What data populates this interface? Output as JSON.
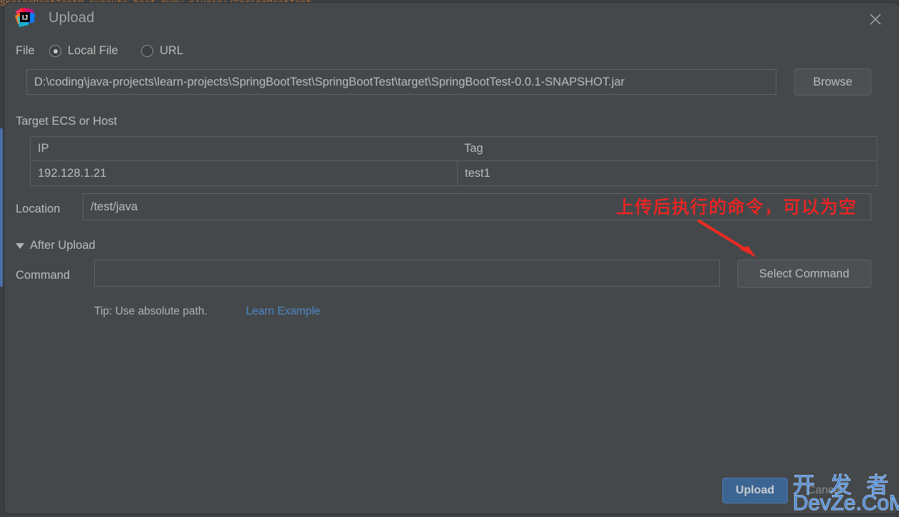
{
  "background": {
    "code_line": "SpringBootTest@ execute boot mvnw  plugin:/SpringBootTest"
  },
  "dialog": {
    "title": "Upload",
    "app_icon": "intellij-idea-icon",
    "close_icon": "close-icon",
    "file": {
      "label": "File",
      "options": [
        {
          "label": "Local File",
          "selected": true
        },
        {
          "label": "URL",
          "selected": false
        }
      ],
      "path_value": "D:\\coding\\java-projects\\learn-projects\\SpringBootTest\\SpringBootTest\\target\\SpringBootTest-0.0.1-SNAPSHOT.jar",
      "browse_label": "Browse"
    },
    "target": {
      "label": "Target ECS or Host",
      "columns": [
        "IP",
        "Tag"
      ],
      "rows": [
        {
          "ip": "192.128.1.21",
          "tag": "test1"
        }
      ]
    },
    "location": {
      "label": "Location",
      "value": "/test/java"
    },
    "after_upload": {
      "section_label": "After Upload",
      "expanded": true,
      "command_label": "Command",
      "command_value": "",
      "select_command_label": "Select Command",
      "tip": "Tip: Use absolute path.",
      "link_label": "Learn Example"
    },
    "footer": {
      "upload_label": "Upload",
      "cancel_label": "Cancel"
    }
  },
  "annotation": {
    "text": "上传后执行的命令，可以为空",
    "color": "#ff2020",
    "arrow": "red-arrow-icon"
  },
  "watermark": {
    "line1": "开 发 者",
    "line2": "DevZe.CoM",
    "color": "#3f7fd0"
  }
}
